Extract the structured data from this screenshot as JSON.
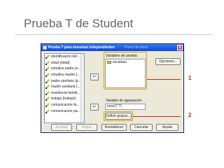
{
  "slide": {
    "title": "Prueba T de Student"
  },
  "dialog": {
    "title": "Prueba T para muestras independientes",
    "title_extra": "Panel de datos",
    "close_symbol": "x",
    "source_list": [
      "identificación del ...",
      "edad [edad]",
      "estudios padre [e...",
      "estudios madre [...",
      "padre sanitario [p...",
      "madre sanitaria [...",
      "residencia familir...",
      "trabajo [trabajo]",
      "comunicacion fa...",
      "comunicacion pa..."
    ],
    "arrow_symbol": "↵",
    "test_label": "Variables de prueba:",
    "test_vars": [
      "escalaas"
    ],
    "group_label": "Variable de agrupación:",
    "group_value": "sexo(? ?)",
    "define_groups": "Definir grupos...",
    "options": "Opciones...",
    "buttons": {
      "accept": "Aceptar",
      "paste": "Pegar",
      "reset": "Restablecer",
      "cancel": "Cancelar",
      "help": "Ayuda"
    }
  },
  "callouts": {
    "one": "1",
    "two": "2"
  },
  "colors": {
    "callout": "#d42020",
    "highlight": "#e0a000",
    "titlebar": "#1c5ae0"
  }
}
